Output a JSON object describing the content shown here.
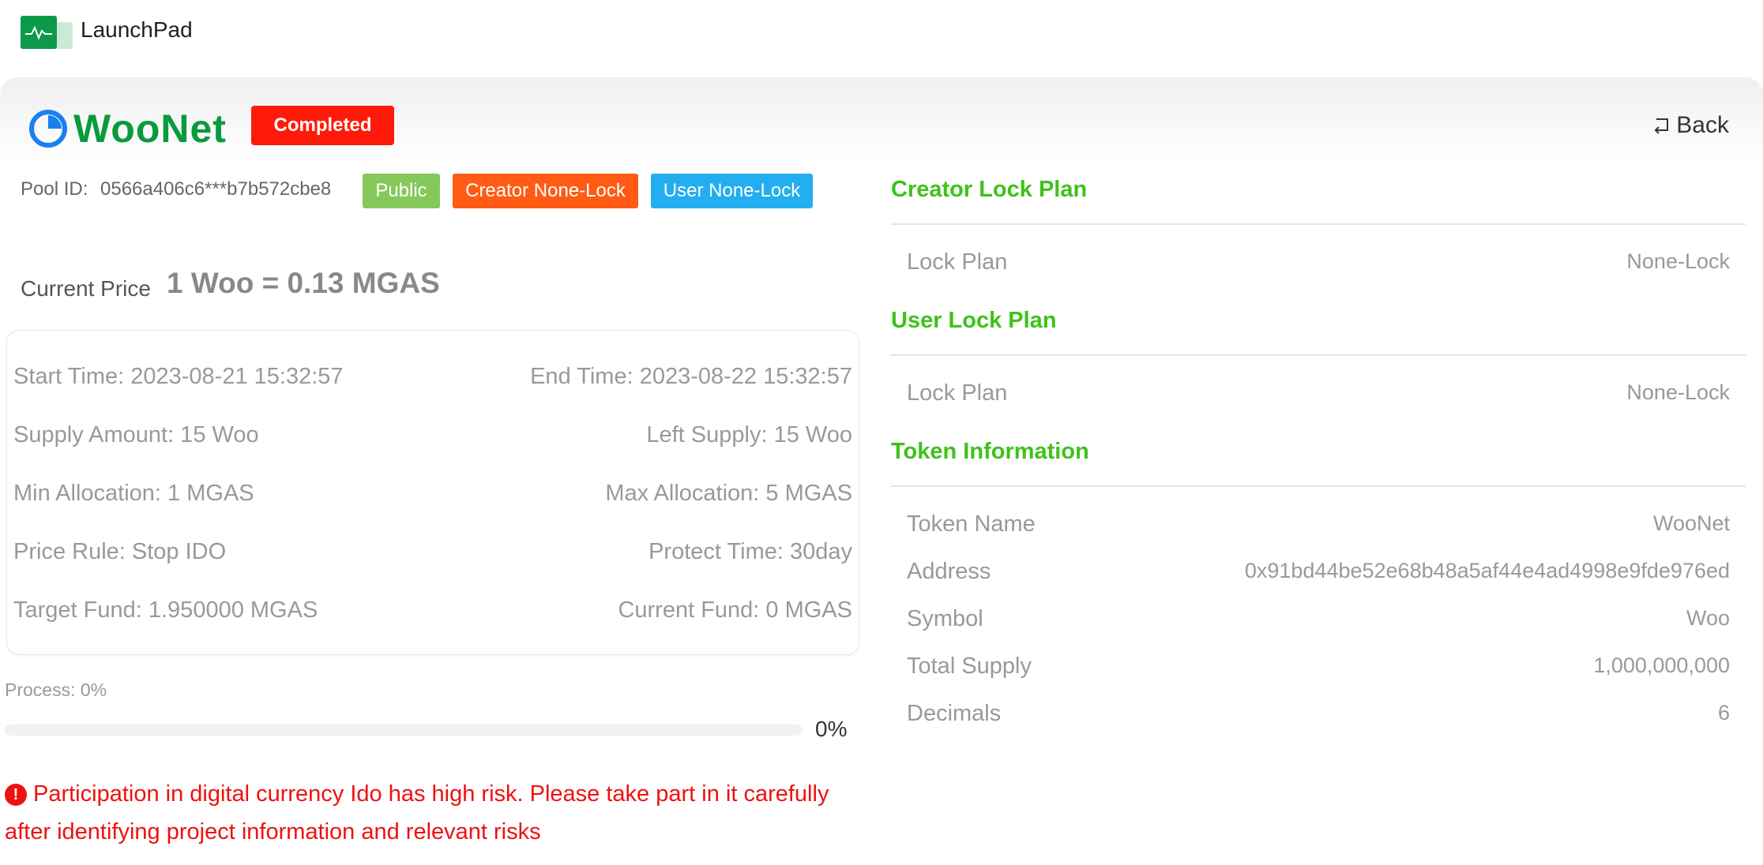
{
  "app": {
    "title": "LaunchPad",
    "logo_icon": "pulse-chart-icon"
  },
  "project": {
    "name": "WooNet",
    "icon": "woonet-logo-icon",
    "status": "Completed",
    "back_label": "Back"
  },
  "pool": {
    "label": "Pool ID:",
    "id": "0566a406c6***b7b572cbe8",
    "tags": [
      "Public",
      "Creator None-Lock",
      "User None-Lock"
    ]
  },
  "price": {
    "label": "Current Price",
    "value": "1 Woo = 0.13 MGAS"
  },
  "details": {
    "start_time": "Start Time: 2023-08-21 15:32:57",
    "end_time": "End Time: 2023-08-22 15:32:57",
    "supply_amount": "Supply Amount: 15 Woo",
    "left_supply": "Left Supply: 15 Woo",
    "min_allocation": "Min Allocation: 1 MGAS",
    "max_allocation": "Max Allocation: 5 MGAS",
    "price_rule": "Price Rule: Stop IDO",
    "protect_time": "Protect Time: 30day",
    "target_fund": "Target Fund: 1.950000 MGAS",
    "current_fund": "Current Fund: 0 MGAS"
  },
  "progress": {
    "label": "Process: 0%",
    "percent_text": "0%",
    "fraction": 0
  },
  "warning": {
    "text": "Participation in digital currency Ido has high risk. Please take part in it carefully after identifying project information and relevant risks"
  },
  "creator_lock": {
    "title": "Creator Lock Plan",
    "key": "Lock Plan",
    "value": "None-Lock"
  },
  "user_lock": {
    "title": "User Lock Plan",
    "key": "Lock Plan",
    "value": "None-Lock"
  },
  "token": {
    "title": "Token Information",
    "rows": [
      {
        "key": "Token Name",
        "value": "WooNet"
      },
      {
        "key": "Address",
        "value": "0x91bd44be52e68b48a5af44e4ad4998e9fde976ed"
      },
      {
        "key": "Symbol",
        "value": "Woo"
      },
      {
        "key": "Total Supply",
        "value": "1,000,000,000"
      },
      {
        "key": "Decimals",
        "value": "6"
      }
    ]
  },
  "colors": {
    "brand_green": "#0a9a3e",
    "section_green": "#3ec21a",
    "completed_red": "#ff1a0a",
    "public_green": "#85c95a",
    "creator_orange": "#ff5b14",
    "user_blue": "#22aef0",
    "warning_red": "#ee1111"
  }
}
